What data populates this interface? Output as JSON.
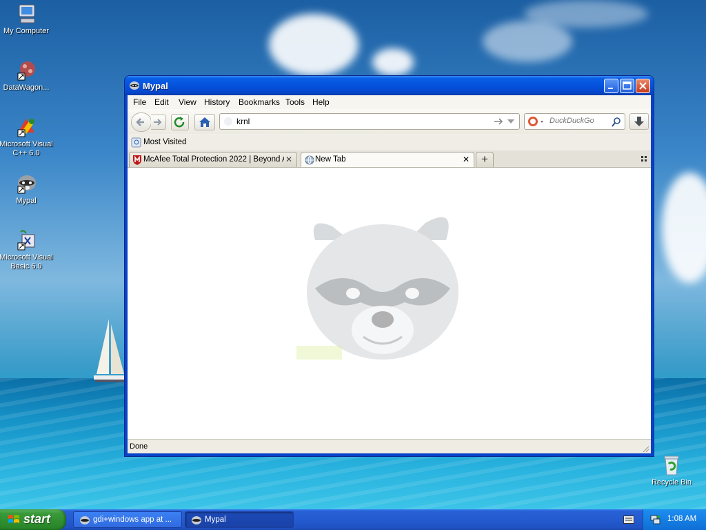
{
  "desktop": {
    "icons": [
      {
        "label": "My Computer"
      },
      {
        "label": "DataWagon..."
      },
      {
        "label": "Microsoft Visual C++ 6.0"
      },
      {
        "label": "Mypal"
      },
      {
        "label": "Microsoft Visual Basic 6.0"
      },
      {
        "label": "Recycle Bin"
      }
    ]
  },
  "window": {
    "title": "Mypal",
    "menu": [
      "File",
      "Edit",
      "View",
      "History",
      "Bookmarks",
      "Tools",
      "Help"
    ],
    "url_value": "krnl",
    "search_placeholder": "DuckDuckGo",
    "bookmarks": {
      "most_visited": "Most Visited"
    },
    "tabs": [
      {
        "label": "McAfee Total Protection 2022 | Beyond A...",
        "active": false
      },
      {
        "label": "New Tab",
        "active": true
      }
    ],
    "tab_close_glyph": "✕",
    "new_tab_glyph": "+",
    "status": "Done"
  },
  "taskbar": {
    "start_label": "start",
    "tasks": [
      {
        "label": "gdi+windows app at ..."
      },
      {
        "label": "Mypal"
      }
    ],
    "clock": "1:08 AM"
  },
  "colors": {
    "titlebar_blue": "#0552dd",
    "taskbar_blue": "#245bd0",
    "start_green": "#3a9a3a",
    "close_red": "#c6391b"
  }
}
